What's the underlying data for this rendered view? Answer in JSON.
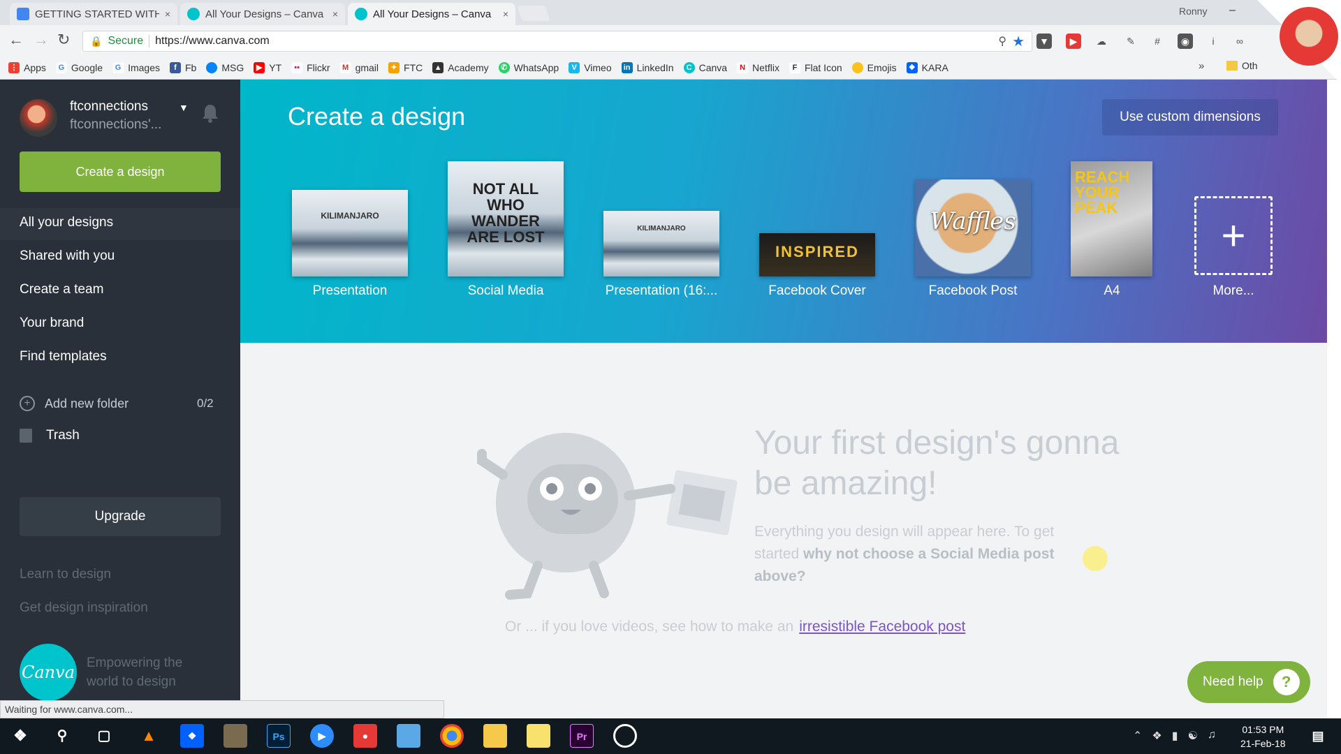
{
  "browser": {
    "tabs": [
      {
        "title": "GETTING STARTED WITH",
        "close": "×"
      },
      {
        "title": "All Your Designs – Canva",
        "close": "×"
      },
      {
        "title": "All Your Designs – Canva",
        "close": "×"
      }
    ],
    "profile_name": "Ronny",
    "minimize": "–",
    "secure_label": "Secure",
    "url": "https://www.canva.com",
    "bookmarks": [
      "Apps",
      "Google",
      "Images",
      "Fb",
      "MSG",
      "YT",
      "Flickr",
      "gmail",
      "FTC",
      "Academy",
      "WhatsApp",
      "Vimeo",
      "LinkedIn",
      "Canva",
      "Netflix",
      "Flat Icon",
      "Emojis",
      "KARA"
    ],
    "bookmarks_more": "»",
    "bookmarks_other": "Oth",
    "status": "Waiting for www.canva.com..."
  },
  "sidebar": {
    "user_name": "ftconnections",
    "user_sub": "ftconnections'...",
    "create_button": "Create a design",
    "nav": [
      "All your designs",
      "Shared with you",
      "Create a team",
      "Your brand",
      "Find templates"
    ],
    "add_folder": "Add new folder",
    "folder_count": "0/2",
    "trash": "Trash",
    "upgrade": "Upgrade",
    "learn": "Learn to design",
    "inspiration": "Get design inspiration",
    "logo": "Canva",
    "tagline": "Empowering the world to design"
  },
  "banner": {
    "title": "Create a design",
    "custom_button": "Use custom dimensions",
    "templates": [
      {
        "label": "Presentation",
        "art": "KILIMANJARO"
      },
      {
        "label": "Social Media",
        "art": "NOT ALL WHO WANDER ARE LOST"
      },
      {
        "label": "Presentation (16:...",
        "art": "KILIMANJARO"
      },
      {
        "label": "Facebook Cover",
        "art": "INSPIRED"
      },
      {
        "label": "Facebook Post",
        "art": "Waffles"
      },
      {
        "label": "A4",
        "art": "REACH YOUR PEAK"
      },
      {
        "label": "More...",
        "art": "+"
      }
    ]
  },
  "empty_state": {
    "title": "Your first design's gonna be amazing!",
    "body_plain": "Everything you design will appear here. To get started",
    "body_bold": "why not choose a Social Media post above?",
    "or_text": "Or ... if you love videos, see how to make an",
    "link": "irresistible Facebook post"
  },
  "help_button": "Need help",
  "help_icon": "?",
  "taskbar": {
    "time": "01:53 PM",
    "date": "21-Feb-18",
    "icons": [
      "windows-start",
      "search",
      "task-view",
      "vlc",
      "dropbox",
      "app",
      "photoshop",
      "zoom",
      "screen-recorder",
      "app",
      "chrome",
      "file-explorer",
      "sticky-notes",
      "premiere",
      "app"
    ]
  },
  "colors": {
    "sidebar": "#293039",
    "accent_green": "#7fb33d",
    "link": "#7b55c7",
    "banner_start": "#00b7c9",
    "banner_end": "#6c4aa5"
  }
}
